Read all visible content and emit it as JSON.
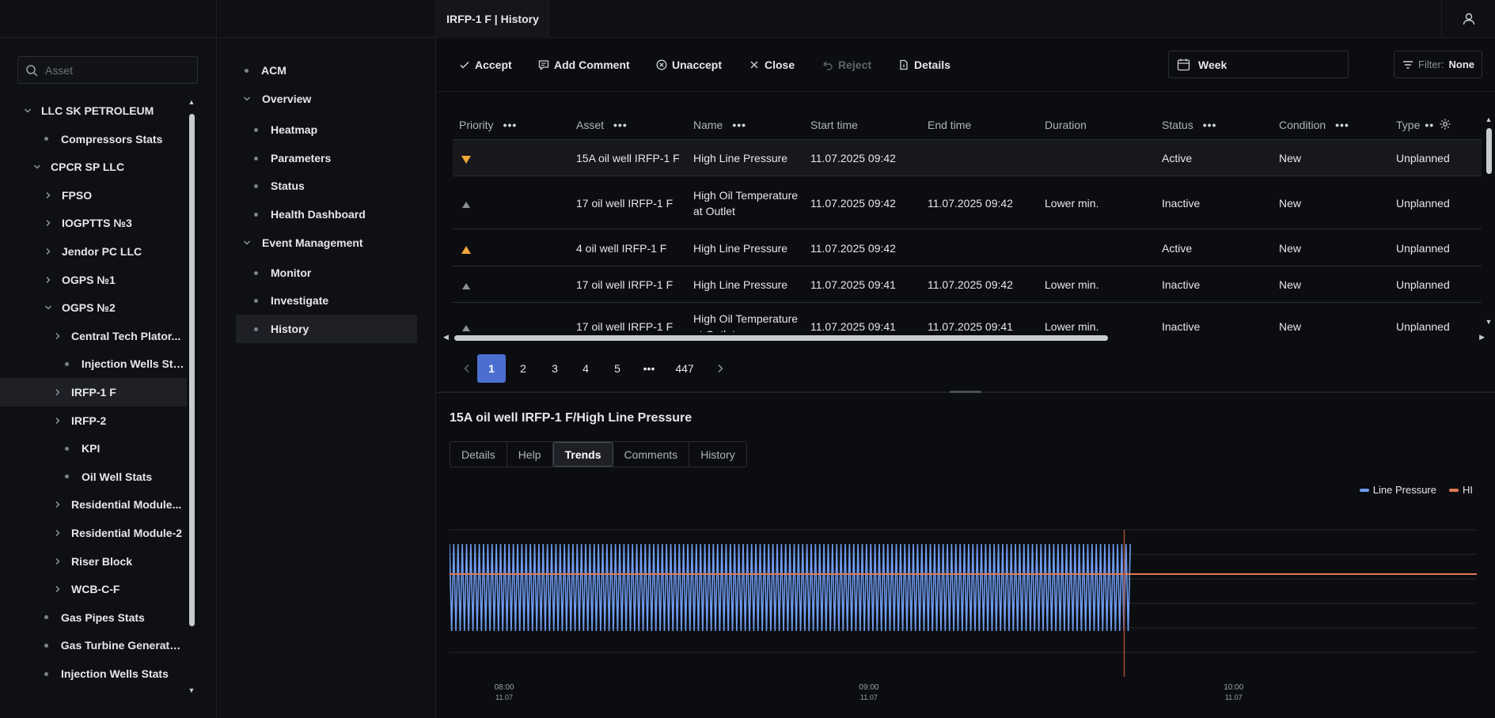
{
  "tree": {
    "search_placeholder": "Asset",
    "items": [
      {
        "label": "LLC SK PETROLEUM",
        "kind": "chevron-open",
        "level": 0
      },
      {
        "label": "Compressors Stats",
        "kind": "dot",
        "level": 1
      },
      {
        "label": "CPCR SP LLC",
        "kind": "chevron-open",
        "level": 1
      },
      {
        "label": "FPSO",
        "kind": "chevron-closed",
        "level": 2
      },
      {
        "label": "IOGPTTS №3",
        "kind": "chevron-closed",
        "level": 2
      },
      {
        "label": "Jendor PC LLC",
        "kind": "chevron-closed",
        "level": 2
      },
      {
        "label": "OGPS №1",
        "kind": "chevron-closed",
        "level": 2
      },
      {
        "label": "OGPS №2",
        "kind": "chevron-open",
        "level": 2
      },
      {
        "label": "Central Tech Plator...",
        "kind": "chevron-closed",
        "level": 3
      },
      {
        "label": "Injection Wells Stats",
        "kind": "dot",
        "level": 3
      },
      {
        "label": "IRFP-1 F",
        "kind": "chevron-closed",
        "level": 3,
        "selected": true
      },
      {
        "label": "IRFP-2",
        "kind": "chevron-closed",
        "level": 3
      },
      {
        "label": "KPI",
        "kind": "dot",
        "level": 3
      },
      {
        "label": "Oil Well Stats",
        "kind": "dot",
        "level": 3
      },
      {
        "label": "Residential Module...",
        "kind": "chevron-closed",
        "level": 3
      },
      {
        "label": "Residential Module-2",
        "kind": "chevron-closed",
        "level": 3
      },
      {
        "label": "Riser Block",
        "kind": "chevron-closed",
        "level": 3
      },
      {
        "label": "WCB-C-F",
        "kind": "chevron-closed",
        "level": 3
      },
      {
        "label": "Gas Pipes Stats",
        "kind": "dot",
        "level": 1
      },
      {
        "label": "Gas Turbine Generator ...",
        "kind": "dot",
        "level": 1
      },
      {
        "label": "Injection Wells Stats",
        "kind": "dot",
        "level": 1
      }
    ]
  },
  "nav": {
    "items": [
      {
        "label": "ACM",
        "kind": "dot",
        "level": 0
      },
      {
        "label": "Overview",
        "kind": "chevron-open",
        "level": 0
      },
      {
        "label": "Heatmap",
        "kind": "dot",
        "level": 1
      },
      {
        "label": "Parameters",
        "kind": "dot",
        "level": 1
      },
      {
        "label": "Status",
        "kind": "dot",
        "level": 1
      },
      {
        "label": "Health Dashboard",
        "kind": "dot",
        "level": 1
      },
      {
        "label": "Event Management",
        "kind": "chevron-open",
        "level": 0
      },
      {
        "label": "Monitor",
        "kind": "dot",
        "level": 1
      },
      {
        "label": "Investigate",
        "kind": "dot",
        "level": 1
      },
      {
        "label": "History",
        "kind": "dot",
        "level": 1,
        "selected": true
      }
    ]
  },
  "tab": {
    "title": "IRFP-1 F | History"
  },
  "toolbar": {
    "accept": "Accept",
    "add_comment": "Add Comment",
    "unaccept": "Unaccept",
    "close": "Close",
    "reject": "Reject",
    "details": "Details",
    "period": "Week",
    "filter_key": "Filter:",
    "filter_value": "None"
  },
  "table": {
    "columns": [
      "Priority",
      "Asset",
      "Name",
      "Start time",
      "End time",
      "Duration",
      "Status",
      "Condition",
      "Type"
    ],
    "rows": [
      {
        "priority": "high-orange-down",
        "asset": "15A oil well IRFP-1 F",
        "name": [
          "High Line Pressure"
        ],
        "start": "11.07.2025 09:42",
        "end": "",
        "duration": "",
        "status": "Active",
        "condition": "New",
        "type": "Unplanned"
      },
      {
        "priority": "low-gray",
        "asset": "17 oil well IRFP-1 F",
        "name": [
          "High Oil Temperature",
          "at Outlet"
        ],
        "start": "11.07.2025 09:42",
        "end": "11.07.2025 09:42",
        "duration": "Lower min.",
        "status": "Inactive",
        "condition": "New",
        "type": "Unplanned"
      },
      {
        "priority": "medium-orange",
        "asset": "4 oil well IRFP-1 F",
        "name": [
          "High Line Pressure"
        ],
        "start": "11.07.2025 09:42",
        "end": "",
        "duration": "",
        "status": "Active",
        "condition": "New",
        "type": "Unplanned"
      },
      {
        "priority": "low-gray",
        "asset": "17 oil well IRFP-1 F",
        "name": [
          "High Line Pressure"
        ],
        "start": "11.07.2025 09:41",
        "end": "11.07.2025 09:42",
        "duration": "Lower min.",
        "status": "Inactive",
        "condition": "New",
        "type": "Unplanned"
      },
      {
        "priority": "low-gray",
        "asset": "17 oil well IRFP-1 F",
        "name": [
          "High Oil Temperature",
          "at Outlet"
        ],
        "start": "11.07.2025 09:41",
        "end": "11.07.2025 09:41",
        "duration": "Lower min.",
        "status": "Inactive",
        "condition": "New",
        "type": "Unplanned"
      }
    ]
  },
  "pager": {
    "pages": [
      "1",
      "2",
      "3",
      "4",
      "5",
      "•••",
      "447"
    ],
    "current": "1"
  },
  "detail": {
    "title": "15A oil well IRFP-1 F/High Line Pressure",
    "tabs": [
      "Details",
      "Help",
      "Trends",
      "Comments",
      "History"
    ],
    "active_tab": "Trends"
  },
  "chart_data": {
    "type": "line",
    "series": [
      {
        "name": "Line Pressure",
        "color": "#6f9cf0",
        "pattern": "oscillating",
        "x_start": "07:51",
        "x_end": "09:43"
      },
      {
        "name": "HI",
        "color": "#e07a55",
        "pattern": "constant",
        "x_start": "07:51",
        "x_end": "10:40"
      }
    ],
    "x_ticks": [
      {
        "time": "08:00",
        "date": "11.07"
      },
      {
        "time": "09:00",
        "date": "11.07"
      },
      {
        "time": "10:00",
        "date": "11.07"
      }
    ],
    "marker_time": "09:42",
    "legend_position": "top-right",
    "grid": true
  },
  "colors": {
    "accent": "#4a6fd0",
    "priority_orange": "#f2a63a",
    "priority_gray": "#8a8f98"
  }
}
